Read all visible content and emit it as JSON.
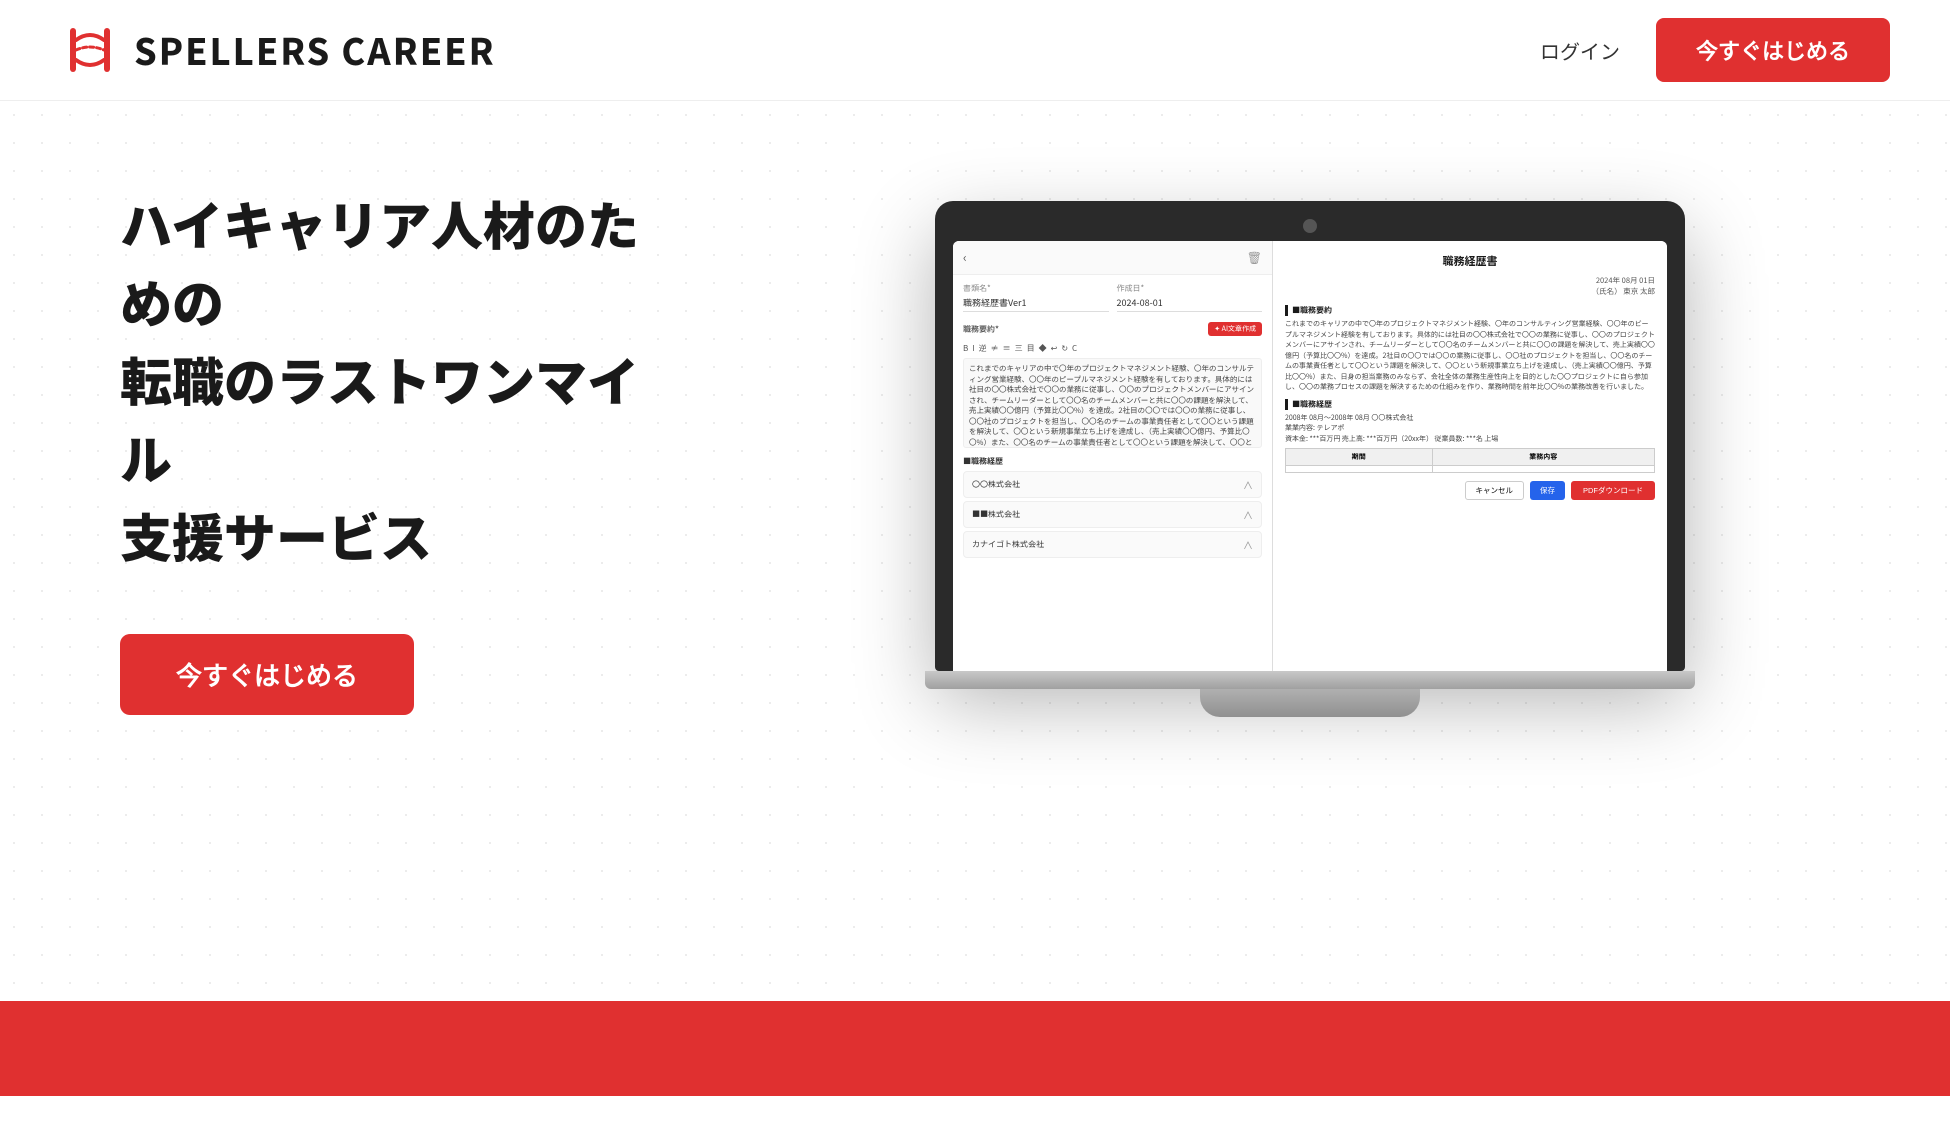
{
  "header": {
    "logo_text": "SPELLERS CAREER",
    "login_label": "ログイン",
    "cta_label": "今すぐはじめる"
  },
  "hero": {
    "headline_line1": "ハイキャリア人材のための",
    "headline_line2": "転職のラストワンマイル",
    "headline_line3": "支援サービス",
    "cta_label": "今すぐはじめる"
  },
  "app_ui": {
    "doc_title_label": "書類名*",
    "doc_title_value": "職務経歴書Ver1",
    "created_label": "作成日*",
    "created_value": "2024-08-01",
    "summary_label": "職務要約*",
    "ai_badge": "✦ AI文章作成",
    "toolbar_items": [
      "B",
      "I",
      "逆",
      "≠",
      "≡",
      "三",
      "目",
      "◆",
      "↩",
      "↻",
      "C"
    ],
    "summary_text": "これまでのキャリアの中で〇年のプロジェクトマネジメント経験、〇年のコンサルティング営業経験、〇〇年のピープルマネジメント経験を有しております。具体的には社目の〇〇株式会社で〇〇の業務に従事し、〇〇のプロジェクトメンバーにアサインされ、チームリーダーとして〇〇名のチームメンバーと共に〇〇の課題を解決して、売上実績〇〇億円（予算比〇〇%）を達成。2社目の〇〇では〇〇の業務に従事し、〇〇社のプロジェクトを担当し、〇〇名のチームの事業責任者として〇〇という課題を解決して、〇〇という新規事業立ち上げを達成し、（売上実績〇〇億円、予算比〇〇%）また、〇〇名のチームの事業責任者として〇〇という課題を解決して、〇〇という新規事業立ち上",
    "work_history_label": "■職務経歴",
    "companies": [
      {
        "name": "〇〇株式会社"
      },
      {
        "name": "■■株式会社"
      },
      {
        "name": "カナイゴト株式会社"
      }
    ],
    "preview_title": "職務経歴書",
    "preview_date": "2024年 08月 01日",
    "preview_name": "（氏名） 東京 太郎",
    "preview_summary_heading": "■職務要約",
    "preview_summary_text": "これまでのキャリアの中で〇年のプロジェクトマネジメント経験、〇年のコンサルティング営業経験、〇〇年のピープルマネジメント経験を有しております。具体的には社目の〇〇株式会社で〇〇の業務に従事し、〇〇のプロジェクトメンバーにアサインされ、チームリーダーとして〇〇名のチームメンバーと共に〇〇の課題を解決して、売上実績〇〇億円（予算比〇〇%）を達成。2社目の〇〇では〇〇の業務に従事し、〇〇社のプロジェクトを担当し、〇〇名のチームの事業責任者として〇〇という課題を解決して、〇〇という新規事業立ち上げを達成し、（売上実績〇〇億円、予算比〇〇%）また、日身の担当業務のみならず、会社全体の業務生産性向上を目的とした〇〇プロジェクトに自ら参加し、〇〇の業務プロセスの課題を解決するための仕組みを作り、業務時間を前年比〇〇%の業務改善を行いました。",
    "preview_work_heading": "■職務経歴",
    "preview_company": "2008年 08月〜2008年 08月 〇〇株式会社",
    "preview_department": "業業内容: テレアポ",
    "preview_salary": "資本金: ***百万円 売上高: ***百万円（20xx年） 従業員数: ***名 上場",
    "preview_table_col1": "期間",
    "preview_table_col2": "業務内容",
    "btn_cancel": "キャンセル",
    "btn_save": "保存",
    "btn_pdf": "PDFダウンロード"
  },
  "colors": {
    "accent_red": "#e03030",
    "cta_blue": "#2563eb"
  }
}
